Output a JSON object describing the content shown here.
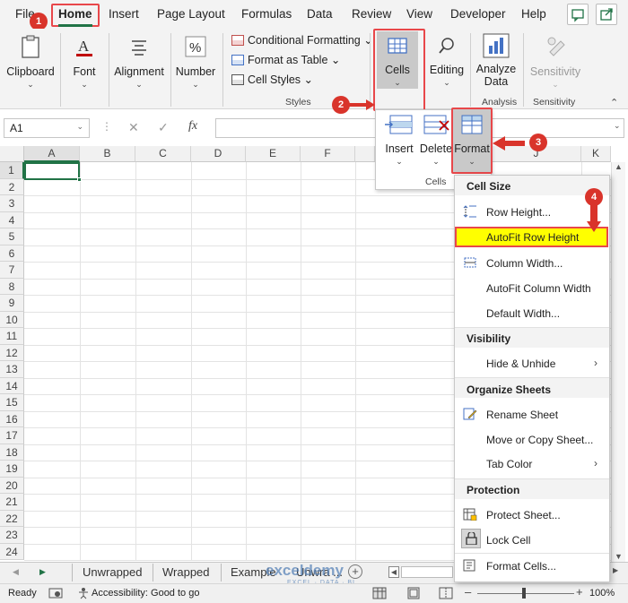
{
  "tabs": {
    "file": "File",
    "home": "Home",
    "insert": "Insert",
    "page_layout": "Page Layout",
    "formulas": "Formulas",
    "data": "Data",
    "review": "Review",
    "view": "View",
    "developer": "Developer",
    "help": "Help"
  },
  "ribbon": {
    "clipboard": "Clipboard",
    "font": "Font",
    "alignment": "Alignment",
    "number": "Number",
    "conditional_formatting": "Conditional Formatting",
    "format_as_table": "Format as Table",
    "cell_styles": "Cell Styles",
    "styles_group": "Styles",
    "cells": "Cells",
    "editing": "Editing",
    "analyze_data": "Analyze Data",
    "analysis_group": "Analysis",
    "sensitivity": "Sensitivity",
    "sensitivity_group": "Sensitivity"
  },
  "formula_bar": {
    "name_box": "A1",
    "fx": "fx"
  },
  "columns": [
    "A",
    "B",
    "C",
    "D",
    "E",
    "F",
    "J",
    "K"
  ],
  "rows": [
    "1",
    "2",
    "3",
    "4",
    "5",
    "6",
    "7",
    "8",
    "9",
    "10",
    "11",
    "12",
    "13",
    "14",
    "15",
    "16",
    "17",
    "18",
    "19",
    "20",
    "21",
    "22",
    "23",
    "24"
  ],
  "cells_panel": {
    "insert": "Insert",
    "delete": "Delete",
    "format": "Format",
    "group": "Cells"
  },
  "format_menu": {
    "cell_size": "Cell Size",
    "row_height": "Row Height...",
    "autofit_row_height": "AutoFit Row Height",
    "column_width": "Column Width...",
    "autofit_column_width": "AutoFit Column Width",
    "default_width": "Default Width...",
    "visibility": "Visibility",
    "hide_unhide": "Hide & Unhide",
    "organize_sheets": "Organize Sheets",
    "rename_sheet": "Rename Sheet",
    "move_copy_sheet": "Move or Copy Sheet...",
    "tab_color": "Tab Color",
    "protection": "Protection",
    "protect_sheet": "Protect Sheet...",
    "lock_cell": "Lock Cell",
    "format_cells": "Format Cells..."
  },
  "sheet_tabs": [
    "Unwrapped",
    "Wrapped",
    "Example",
    "Unwra ..."
  ],
  "status": {
    "ready": "Ready",
    "accessibility": "Accessibility: Good to go",
    "zoom": "100%"
  },
  "watermark": "exceldemy",
  "watermark_sub": "EXCEL · DATA · BI",
  "badges": [
    "1",
    "2",
    "3",
    "4"
  ],
  "colors": {
    "excel_green": "#217346",
    "highlight_red": "#e8474a",
    "badge_red": "#d9342b",
    "autofit_yellow": "#ffff00"
  }
}
